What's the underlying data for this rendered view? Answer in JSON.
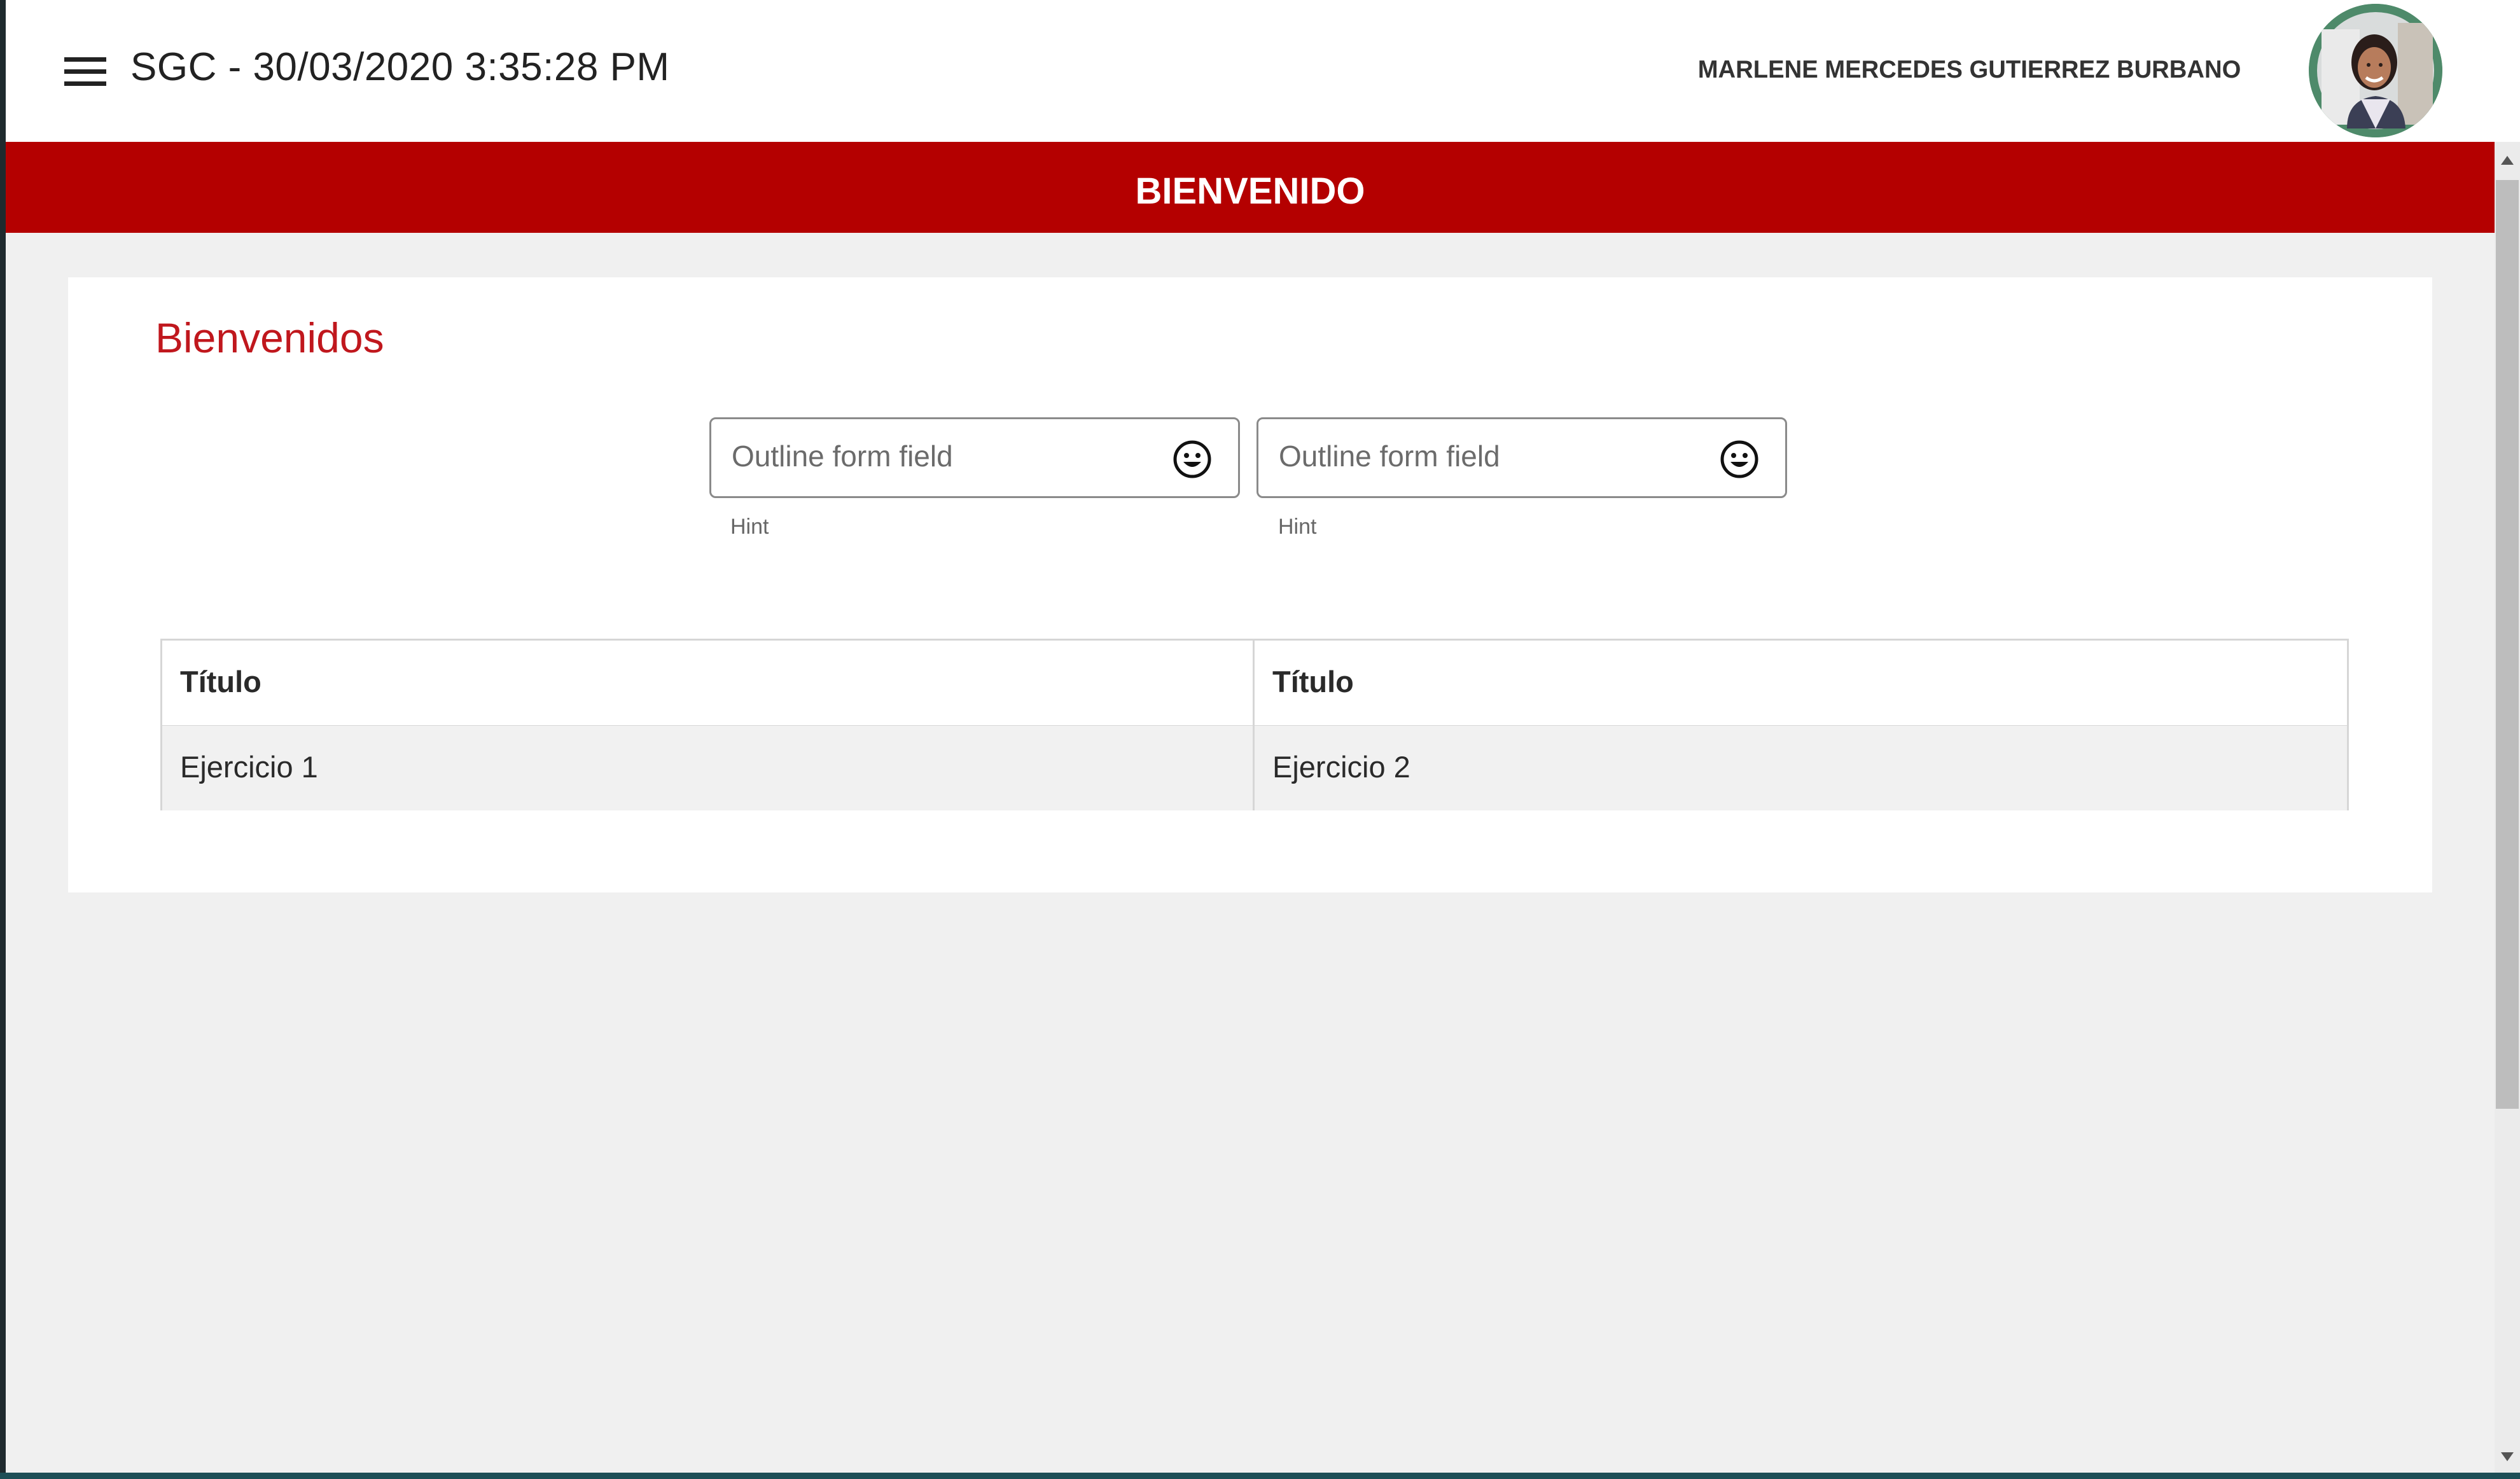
{
  "toolbar": {
    "title": "SGC - 30/03/2020 3:35:28 PM",
    "user_name": "MARLENE MERCEDES GUTIERREZ BURBANO",
    "menu_icon": "hamburger-menu-icon",
    "avatar_icon": "user-avatar-photo"
  },
  "banner": {
    "title": "BIENVENIDO"
  },
  "card": {
    "title": "Bienvenidos",
    "fields": [
      {
        "placeholder": "Outline form field",
        "value": "",
        "hint": "Hint",
        "icon": "smiley-face-icon"
      },
      {
        "placeholder": "Outline form field",
        "value": "",
        "hint": "Hint",
        "icon": "smiley-face-icon"
      }
    ],
    "table": {
      "headers": [
        "Título",
        "Título"
      ],
      "rows": [
        [
          "Ejercicio 1",
          "Ejercicio 2"
        ]
      ]
    }
  },
  "colors": {
    "brand_red": "#b40000",
    "title_red": "#c0171d",
    "background": "#f0f0f0"
  }
}
